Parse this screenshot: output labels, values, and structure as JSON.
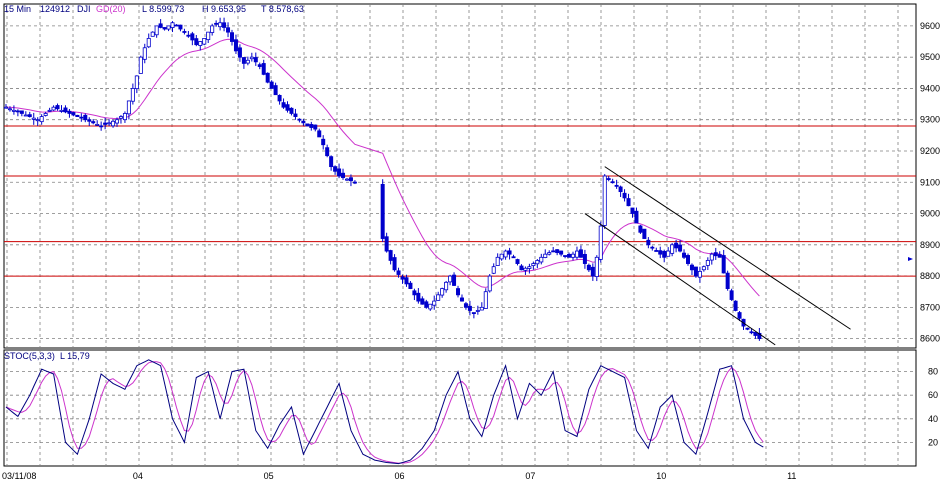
{
  "header": {
    "interval": "15 Min",
    "code": "124912",
    "symbol": "DJI",
    "ma_label": "GD(20)",
    "low": "L  8.599,73",
    "high": "H  9.653,95",
    "last": "T  8.578,63"
  },
  "stoch_header": {
    "name": "STOC(5,3,3)",
    "last": "L  15,79"
  },
  "colors": {
    "candle": "#0000cc",
    "ma": "#cc33cc",
    "support": "#cc0000",
    "channel": "#000000",
    "grid": "#808080",
    "stoch_k": "#000080",
    "stoch_d": "#cc33cc",
    "label": "#000080"
  },
  "chart_data": [
    {
      "type": "candlestick",
      "symbol": "DJI",
      "interval": "15 Min",
      "x_labels": [
        "03/11/08",
        "04",
        "05",
        "06",
        "07",
        "10",
        "11"
      ],
      "y_ticks": [
        8600,
        8700,
        8800,
        8900,
        9000,
        9100,
        9200,
        9300,
        9400,
        9500,
        9600
      ],
      "ylim": [
        8570,
        9670
      ],
      "grid": true,
      "moving_average": "GD(20)",
      "close_path": [
        [
          0,
          9340
        ],
        [
          4,
          9320
        ],
        [
          8,
          9300
        ],
        [
          12,
          9340
        ],
        [
          16,
          9320
        ],
        [
          20,
          9300
        ],
        [
          24,
          9280
        ],
        [
          28,
          9300
        ],
        [
          30,
          9320
        ],
        [
          33,
          9440
        ],
        [
          34,
          9500
        ],
        [
          36,
          9560
        ],
        [
          38,
          9600
        ],
        [
          40,
          9590
        ],
        [
          42,
          9610
        ],
        [
          44,
          9590
        ],
        [
          46,
          9570
        ],
        [
          48,
          9540
        ],
        [
          50,
          9560
        ],
        [
          52,
          9600
        ],
        [
          54,
          9610
        ],
        [
          56,
          9580
        ],
        [
          58,
          9520
        ],
        [
          60,
          9480
        ],
        [
          62,
          9500
        ],
        [
          64,
          9470
        ],
        [
          66,
          9420
        ],
        [
          68,
          9380
        ],
        [
          70,
          9340
        ],
        [
          72,
          9320
        ],
        [
          74,
          9300
        ],
        [
          76,
          9280
        ],
        [
          78,
          9270
        ],
        [
          80,
          9220
        ],
        [
          82,
          9150
        ],
        [
          84,
          9120
        ],
        [
          86,
          9110
        ],
        [
          88,
          9100
        ],
        [
          95,
          8920
        ],
        [
          96,
          8880
        ],
        [
          98,
          8820
        ],
        [
          100,
          8790
        ],
        [
          102,
          8760
        ],
        [
          104,
          8720
        ],
        [
          106,
          8700
        ],
        [
          108,
          8720
        ],
        [
          110,
          8760
        ],
        [
          112,
          8800
        ],
        [
          114,
          8740
        ],
        [
          116,
          8700
        ],
        [
          118,
          8680
        ],
        [
          120,
          8700
        ],
        [
          122,
          8800
        ],
        [
          124,
          8860
        ],
        [
          126,
          8880
        ],
        [
          128,
          8860
        ],
        [
          130,
          8820
        ],
        [
          132,
          8830
        ],
        [
          134,
          8850
        ],
        [
          136,
          8870
        ],
        [
          138,
          8880
        ],
        [
          140,
          8870
        ],
        [
          142,
          8860
        ],
        [
          144,
          8880
        ],
        [
          146,
          8840
        ],
        [
          148,
          8800
        ],
        [
          149,
          8860
        ],
        [
          150,
          8960
        ],
        [
          151,
          9120
        ],
        [
          152,
          9110
        ],
        [
          154,
          9090
        ],
        [
          156,
          9050
        ],
        [
          158,
          9000
        ],
        [
          160,
          8940
        ],
        [
          162,
          8900
        ],
        [
          164,
          8880
        ],
        [
          166,
          8860
        ],
        [
          168,
          8900
        ],
        [
          170,
          8880
        ],
        [
          172,
          8840
        ],
        [
          174,
          8800
        ],
        [
          176,
          8830
        ],
        [
          178,
          8870
        ],
        [
          180,
          8860
        ],
        [
          182,
          8760
        ],
        [
          184,
          8690
        ],
        [
          186,
          8640
        ],
        [
          188,
          8620
        ],
        [
          190,
          8600
        ]
      ],
      "support_lines": [
        9280,
        9120,
        8910,
        8800
      ],
      "channel_lines": [
        {
          "from": [
            151,
            9150
          ],
          "to": [
            213,
            8630
          ]
        },
        {
          "from": [
            146,
            9000
          ],
          "to": [
            194,
            8580
          ]
        }
      ]
    },
    {
      "type": "line",
      "indicator": "STOC(5,3,3)",
      "y_ticks": [
        20,
        40,
        60,
        80
      ],
      "ylim": [
        0,
        100
      ],
      "grid": true,
      "k_path": [
        [
          0,
          50
        ],
        [
          3,
          42
        ],
        [
          6,
          60
        ],
        [
          9,
          82
        ],
        [
          12,
          78
        ],
        [
          15,
          20
        ],
        [
          18,
          10
        ],
        [
          21,
          40
        ],
        [
          24,
          78
        ],
        [
          27,
          70
        ],
        [
          30,
          65
        ],
        [
          33,
          85
        ],
        [
          36,
          90
        ],
        [
          39,
          85
        ],
        [
          42,
          40
        ],
        [
          45,
          20
        ],
        [
          48,
          75
        ],
        [
          51,
          80
        ],
        [
          54,
          40
        ],
        [
          57,
          80
        ],
        [
          60,
          82
        ],
        [
          63,
          30
        ],
        [
          66,
          15
        ],
        [
          69,
          35
        ],
        [
          72,
          50
        ],
        [
          75,
          10
        ],
        [
          78,
          30
        ],
        [
          81,
          50
        ],
        [
          84,
          70
        ],
        [
          87,
          30
        ],
        [
          90,
          10
        ],
        [
          93,
          5
        ],
        [
          96,
          3
        ],
        [
          99,
          2
        ],
        [
          102,
          5
        ],
        [
          105,
          15
        ],
        [
          108,
          30
        ],
        [
          111,
          60
        ],
        [
          114,
          80
        ],
        [
          117,
          40
        ],
        [
          120,
          25
        ],
        [
          123,
          60
        ],
        [
          126,
          85
        ],
        [
          129,
          40
        ],
        [
          132,
          70
        ],
        [
          135,
          60
        ],
        [
          138,
          80
        ],
        [
          141,
          30
        ],
        [
          144,
          25
        ],
        [
          147,
          65
        ],
        [
          150,
          85
        ],
        [
          153,
          80
        ],
        [
          156,
          75
        ],
        [
          159,
          30
        ],
        [
          162,
          15
        ],
        [
          165,
          50
        ],
        [
          168,
          60
        ],
        [
          171,
          20
        ],
        [
          174,
          10
        ],
        [
          177,
          45
        ],
        [
          180,
          82
        ],
        [
          183,
          85
        ],
        [
          186,
          40
        ],
        [
          189,
          20
        ],
        [
          191,
          16
        ]
      ]
    }
  ]
}
